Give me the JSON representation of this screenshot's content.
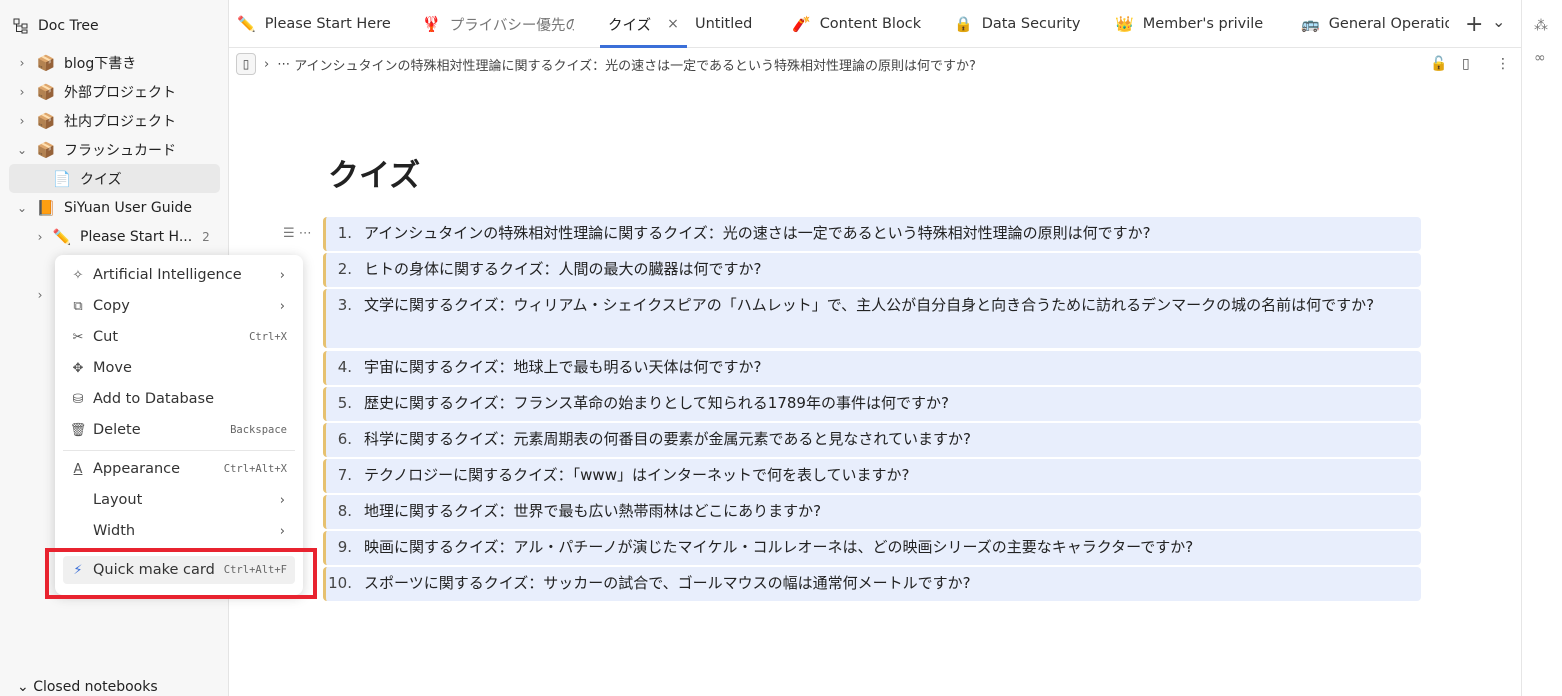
{
  "sidebar": {
    "title": "Doc Tree",
    "items": [
      {
        "label": "blog下書き",
        "icon": "📦",
        "arrow": "›"
      },
      {
        "label": "外部プロジェクト",
        "icon": "📦",
        "arrow": "›"
      },
      {
        "label": "社内プロジェクト",
        "icon": "📦",
        "arrow": "›"
      },
      {
        "label": "フラッシュカード",
        "icon": "📦",
        "arrow": "⌄"
      },
      {
        "label": "クイズ",
        "icon": "📄",
        "arrow": ""
      },
      {
        "label": "SiYuan User Guide",
        "icon": "📙",
        "arrow": "⌄"
      },
      {
        "label": "Please Start H...",
        "icon": "✏️",
        "arrow": "›",
        "count": "2"
      }
    ],
    "closed_notebooks": "Closed notebooks"
  },
  "tabs": [
    {
      "label": "Please Start Here",
      "icon": "✏️"
    },
    {
      "label": "プライバシー優先の",
      "icon": "🦞"
    },
    {
      "label": "クイズ",
      "icon": "",
      "close": "×"
    },
    {
      "label": "Untitled",
      "icon": ""
    },
    {
      "label": "Content Block",
      "icon": "🧨"
    },
    {
      "label": "Data Security",
      "icon": "🔒"
    },
    {
      "label": "Member's privileg",
      "icon": "👑"
    },
    {
      "label": "General Operation",
      "icon": "🚌"
    }
  ],
  "tabbar": {
    "plus": "+",
    "more": "⌄"
  },
  "breadcrumb": {
    "text": "アインシュタインの特殊相対性理論に関するクイズ：光の速さは一定であるという特殊相対性理論の原則は何ですか?"
  },
  "doc": {
    "title": "クイズ",
    "items": [
      {
        "num": "1.",
        "text": "アインシュタインの特殊相対性理論に関するクイズ：光の速さは一定であるという特殊相対性理論の原則は何ですか?"
      },
      {
        "num": "2.",
        "text": "ヒトの身体に関するクイズ：人間の最大の臓器は何ですか?"
      },
      {
        "num": "3.",
        "text": "文学に関するクイズ：ウィリアム・シェイクスピアの「ハムレット」で、主人公が自分自身と向き合うために訪れるデンマークの城の名前は何ですか?"
      },
      {
        "num": "4.",
        "text": "宇宙に関するクイズ：地球上で最も明るい天体は何ですか?"
      },
      {
        "num": "5.",
        "text": "歴史に関するクイズ：フランス革命の始まりとして知られる1789年の事件は何ですか?"
      },
      {
        "num": "6.",
        "text": "科学に関するクイズ：元素周期表の何番目の要素が金属元素であると見なされていますか?"
      },
      {
        "num": "7.",
        "text": "テクノロジーに関するクイズ：「www」はインターネットで何を表していますか?"
      },
      {
        "num": "8.",
        "text": "地理に関するクイズ：世界で最も広い熱帯雨林はどこにありますか?"
      },
      {
        "num": "9.",
        "text": "映画に関するクイズ：アル・パチーノが演じたマイケル・コルレオーネは、どの映画シリーズの主要なキャラクターですか?"
      },
      {
        "num": "10.",
        "text": "スポーツに関するクイズ：サッカーの試合で、ゴールマウスの幅は通常何メートルですか?"
      }
    ]
  },
  "menu": {
    "items": [
      {
        "label": "Artificial Intelligence",
        "icon": "✧",
        "shortcut": "",
        "submenu": true
      },
      {
        "label": "Copy",
        "icon": "⧉",
        "shortcut": "",
        "submenu": true
      },
      {
        "label": "Cut",
        "icon": "✂",
        "shortcut": "Ctrl+X",
        "submenu": false
      },
      {
        "label": "Move",
        "icon": "✥",
        "shortcut": "",
        "submenu": false
      },
      {
        "label": "Add to Database",
        "icon": "⛁",
        "shortcut": "",
        "submenu": false
      },
      {
        "label": "Delete",
        "icon": "🗑",
        "shortcut": "Backspace",
        "submenu": false
      },
      {
        "label": "Appearance",
        "icon": "A",
        "shortcut": "Ctrl+Alt+X",
        "submenu": false
      },
      {
        "label": "Layout",
        "icon": "",
        "shortcut": "",
        "submenu": true
      },
      {
        "label": "Width",
        "icon": "",
        "shortcut": "",
        "submenu": true
      },
      {
        "label": "Quick make card",
        "icon": "⚡",
        "shortcut": "Ctrl+Alt+F",
        "submenu": false
      }
    ]
  },
  "colors": {
    "accent": "#3b6fd8",
    "highlight_box": "#e8232f",
    "block_bg": "#e8eefc"
  }
}
